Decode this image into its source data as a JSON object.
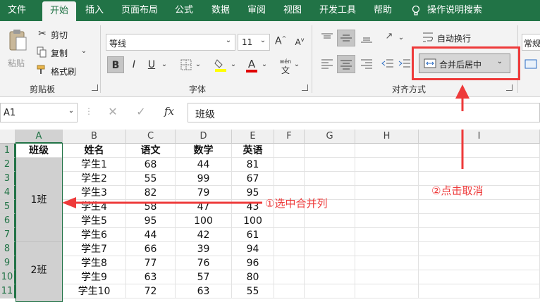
{
  "tabs": [
    {
      "label": "文件",
      "active": false
    },
    {
      "label": "开始",
      "active": true
    },
    {
      "label": "插入",
      "active": false
    },
    {
      "label": "页面布局",
      "active": false
    },
    {
      "label": "公式",
      "active": false
    },
    {
      "label": "数据",
      "active": false
    },
    {
      "label": "审阅",
      "active": false
    },
    {
      "label": "视图",
      "active": false
    },
    {
      "label": "开发工具",
      "active": false
    },
    {
      "label": "帮助",
      "active": false
    }
  ],
  "tell_me": "操作说明搜索",
  "clipboard": {
    "paste": "粘贴",
    "cut": "剪切",
    "copy": "复制",
    "format_painter": "格式刷",
    "group_label": "剪贴板"
  },
  "font": {
    "name": "等线",
    "size": "11",
    "bold": "B",
    "italic": "I",
    "underline": "U",
    "grow": "A",
    "shrink": "A",
    "font_color_letter": "A",
    "phonetic": "文",
    "group_label": "字体"
  },
  "alignment": {
    "wrap_text": "自动换行",
    "merge_center": "合并后居中",
    "group_label": "对齐方式"
  },
  "number": {
    "format_partial": "常规"
  },
  "formula_bar": {
    "cell_ref": "A1",
    "fx": "fx",
    "content": "班级"
  },
  "columns": [
    "A",
    "B",
    "C",
    "D",
    "E",
    "F",
    "G",
    "H",
    "I"
  ],
  "rows": [
    "1",
    "2",
    "3",
    "4",
    "5",
    "6",
    "7",
    "8",
    "9",
    "10",
    "11"
  ],
  "headers": [
    "班级",
    "姓名",
    "语文",
    "数学",
    "英语"
  ],
  "merged_cells": [
    "1班",
    "2班"
  ],
  "table_rows": [
    [
      "学生1",
      "68",
      "44",
      "81"
    ],
    [
      "学生2",
      "55",
      "99",
      "67"
    ],
    [
      "学生3",
      "82",
      "79",
      "95"
    ],
    [
      "学生4",
      "58",
      "47",
      "43"
    ],
    [
      "学生5",
      "95",
      "100",
      "100"
    ],
    [
      "学生6",
      "44",
      "42",
      "61"
    ],
    [
      "学生7",
      "66",
      "39",
      "94"
    ],
    [
      "学生8",
      "77",
      "76",
      "96"
    ],
    [
      "学生9",
      "63",
      "57",
      "80"
    ],
    [
      "学生10",
      "72",
      "63",
      "55"
    ]
  ],
  "annotations": {
    "step1": "①选中合并列",
    "step2": "②点击取消"
  },
  "colors": {
    "excel_green": "#217346",
    "annotation_red": "#ee3a3a",
    "ribbon_bg": "#f3f3f3",
    "selection_gray": "#d0d0d0"
  }
}
